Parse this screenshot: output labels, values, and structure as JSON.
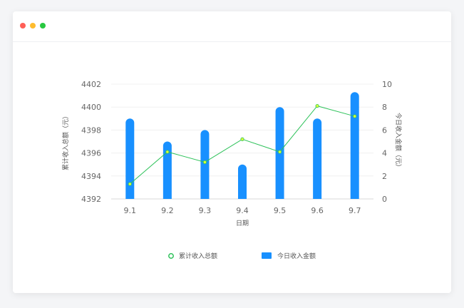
{
  "window": {
    "controls": {
      "close_color": "#ff5f57",
      "minimize_color": "#febc2e",
      "zoom_color": "#28c840"
    }
  },
  "chart_data": {
    "type": "bar",
    "categories": [
      "9.1",
      "9.2",
      "9.3",
      "9.4",
      "9.5",
      "9.6",
      "9.7"
    ],
    "series": [
      {
        "name": "今日收入金额",
        "kind": "bar",
        "axis": "right",
        "color": "#1890ff",
        "values": [
          7,
          5,
          6,
          3,
          8,
          7,
          9.3
        ]
      },
      {
        "name": "累计收入总额",
        "kind": "line",
        "axis": "left",
        "color": "#2fc25b",
        "values": [
          4393.3,
          4396.1,
          4395.2,
          4397.2,
          4396.1,
          4400.1,
          4399.2
        ]
      }
    ],
    "xlabel": "日期",
    "ylabel_left": "累计收入总额（元）",
    "ylabel_right": "今日收入金额（元）",
    "ylim_left": [
      4392,
      4402
    ],
    "ylim_right": [
      0,
      10
    ],
    "yticks_left": [
      4392,
      4394,
      4396,
      4398,
      4400,
      4402
    ],
    "yticks_right": [
      0,
      2,
      4,
      6,
      8,
      10
    ],
    "grid": true,
    "legend_position": "bottom"
  }
}
